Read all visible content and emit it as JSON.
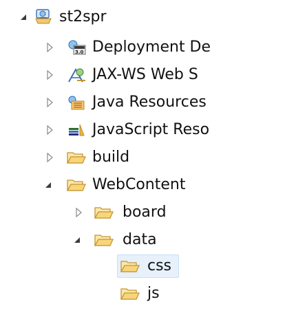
{
  "tree": {
    "project": {
      "label": "st2spr",
      "expanded": true,
      "icon": "web-project-icon"
    },
    "children": [
      {
        "label": "Deployment De",
        "icon": "deployment-descriptor-icon",
        "expanded": false
      },
      {
        "label": "JAX-WS Web S",
        "icon": "jaxws-icon",
        "expanded": false
      },
      {
        "label": "Java Resources",
        "icon": "java-resources-icon",
        "expanded": false
      },
      {
        "label": "JavaScript Reso",
        "icon": "javascript-resources-icon",
        "expanded": false
      },
      {
        "label": "build",
        "icon": "folder-icon",
        "expanded": false
      },
      {
        "label": "WebContent",
        "icon": "folder-icon",
        "expanded": true,
        "children": [
          {
            "label": "board",
            "icon": "folder-icon",
            "expanded": false
          },
          {
            "label": "data",
            "icon": "folder-icon",
            "expanded": true,
            "children": [
              {
                "label": "css",
                "icon": "folder-icon",
                "selected": true
              },
              {
                "label": "js",
                "icon": "folder-icon",
                "selected": false
              }
            ]
          }
        ]
      }
    ]
  },
  "colors": {
    "folder_fill": "#f7d67b",
    "folder_stroke": "#c69433",
    "selection_bg": "#e6f1fb",
    "selection_border": "#c7dff4",
    "arrow": "#8a8a8a",
    "arrow_expanded": "#3c3c3c"
  }
}
